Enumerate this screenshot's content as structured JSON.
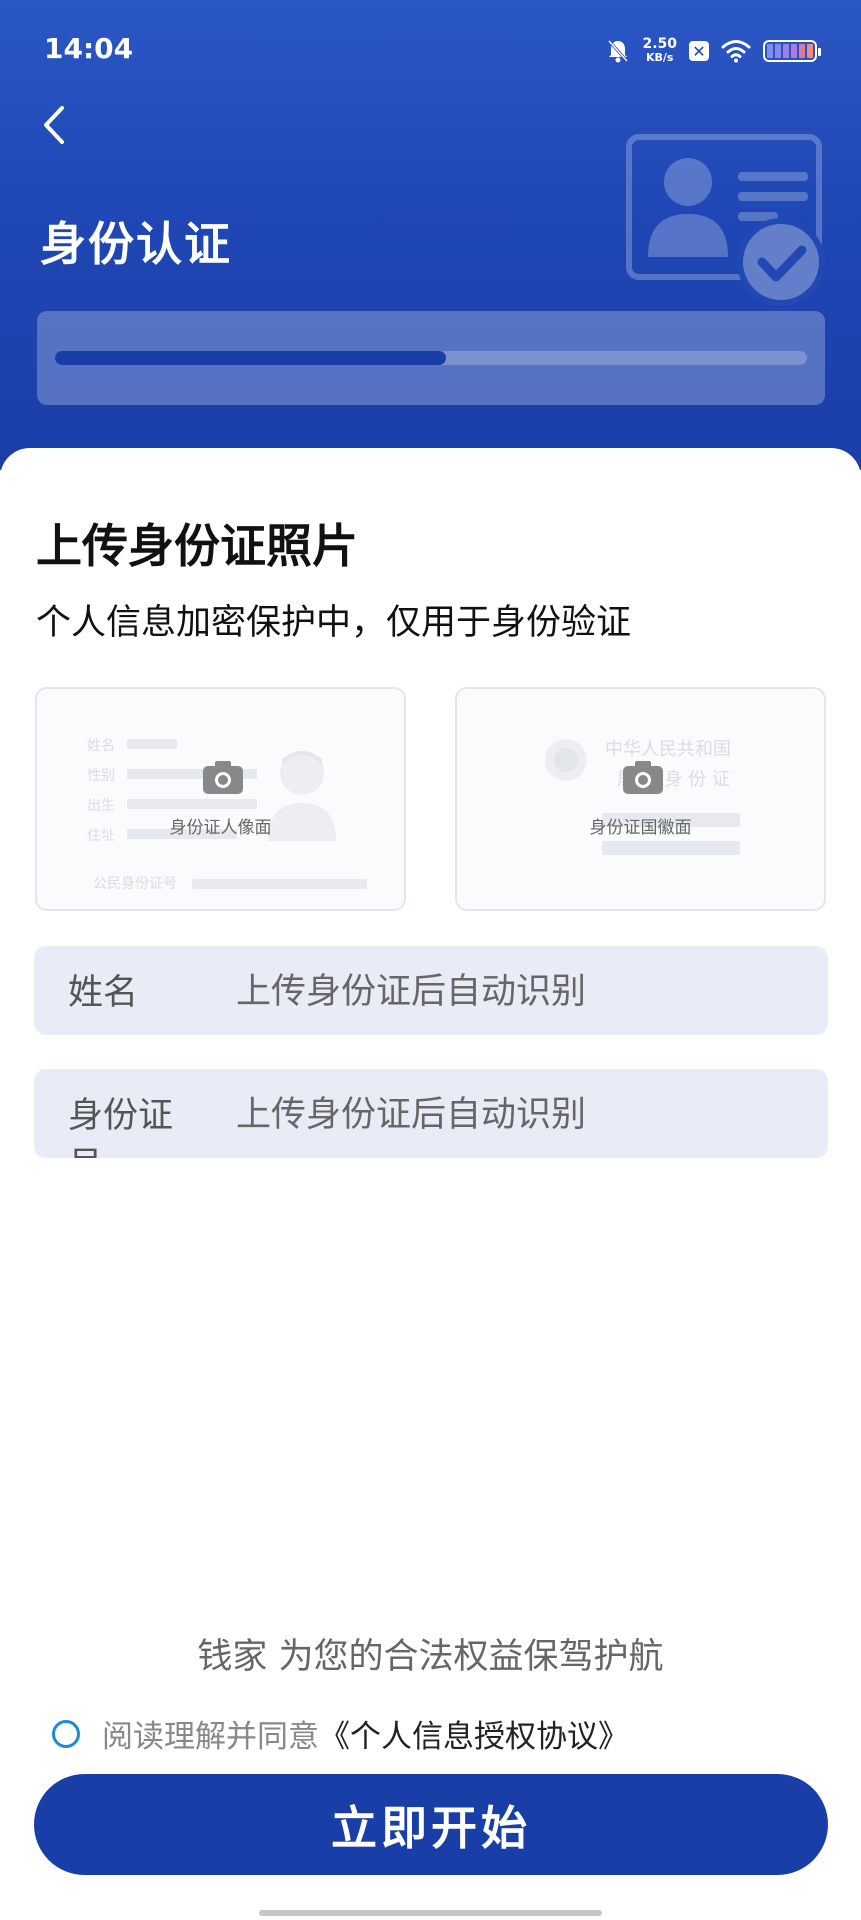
{
  "status_bar": {
    "time": "14:04",
    "net_speed_value": "2.50",
    "net_speed_unit": "KB/s",
    "icons": [
      "mute-bell-icon",
      "x-app-icon",
      "wifi-icon",
      "battery-icon"
    ]
  },
  "header": {
    "back_icon": "chevron-left-icon",
    "title": "身份认证",
    "progress": 0.52,
    "illustration_icon": "id-card-verified-icon"
  },
  "upload": {
    "title": "上传身份证照片",
    "subtitle": "个人信息加密保护中，仅用于身份验证",
    "front": {
      "label": "身份证人像面",
      "icon": "camera-icon",
      "faint_fields": [
        "姓名",
        "性别",
        "出生",
        "住址",
        "公民身份证号"
      ]
    },
    "back": {
      "label": "身份证国徽面",
      "icon": "camera-icon",
      "faint_line1": "中华人民共和国",
      "faint_line2": "居 民 身 份 证"
    }
  },
  "form": {
    "name": {
      "label": "姓名",
      "placeholder": "上传身份证后自动识别"
    },
    "id_number": {
      "label": "身份证号",
      "placeholder": "上传身份证后自动识别"
    }
  },
  "footer": {
    "slogan": "钱家 为您的合法权益保驾护航",
    "agree_text": "阅读理解并同意",
    "agree_link": "《个人信息授权协议》",
    "agree_checked": false,
    "start_button": "立即开始"
  },
  "colors": {
    "primary": "#1a3ea8",
    "header_top": "#2b57c4",
    "field_bg": "#e8ecf6",
    "radio": "#1e8ad6"
  }
}
